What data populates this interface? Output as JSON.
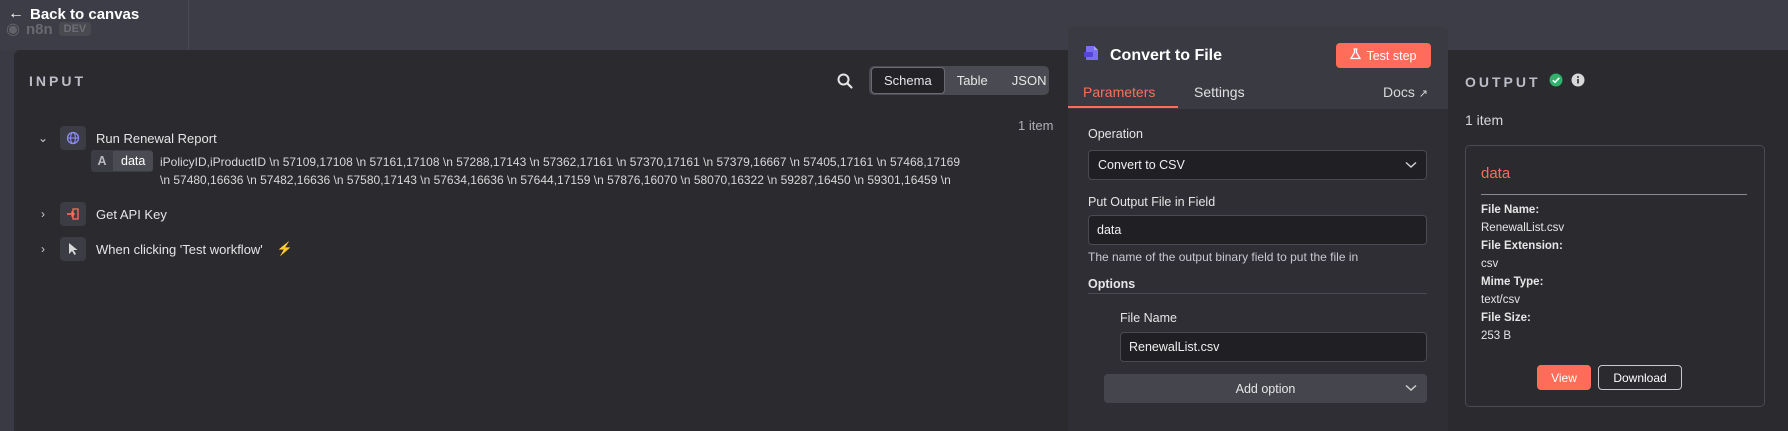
{
  "topbar": {
    "back_label": "Back to canvas",
    "brand_name": "n8n",
    "brand_env": "DEV"
  },
  "input": {
    "title": "INPUT",
    "view_modes": [
      "Schema",
      "Table",
      "JSON"
    ],
    "active_view": "Schema",
    "nodes": [
      {
        "label": "Run Renewal Report",
        "count": "1 item",
        "expanded": true,
        "icon": "globe-icon"
      },
      {
        "label": "Get API Key",
        "expanded": false,
        "icon": "sign-in-icon"
      },
      {
        "label": "When clicking 'Test workflow'",
        "expanded": false,
        "icon": "pointer-icon"
      }
    ],
    "field": {
      "type_letter": "A",
      "key": "data",
      "value_line1": "iPolicyID,iProductID \\n 57109,17108 \\n 57161,17108 \\n 57288,17143 \\n 57362,17161 \\n 57370,17161 \\n 57379,16667 \\n 57405,17161 \\n 57468,17169",
      "value_line2": "\\n 57480,16636 \\n 57482,16636 \\n 57580,17143 \\n 57634,16636 \\n 57644,17159 \\n 57876,16070 \\n 58070,16322 \\n 59287,16450 \\n 59301,16459 \\n"
    }
  },
  "node_panel": {
    "title": "Convert to File",
    "test_step_label": "Test step",
    "tabs": [
      "Parameters",
      "Settings"
    ],
    "active_tab": "Parameters",
    "docs_label": "Docs",
    "operation_label": "Operation",
    "operation_value": "Convert to CSV",
    "output_field_label": "Put Output File in Field",
    "output_field_value": "data",
    "output_field_hint": "The name of the output binary field to put the file in",
    "options_title": "Options",
    "file_name_label": "File Name",
    "file_name_value": "RenewalList.csv",
    "add_option_label": "Add option"
  },
  "output": {
    "title": "OUTPUT",
    "count": "1 item",
    "binary": {
      "name": "data",
      "file_name_label": "File Name:",
      "file_name": "RenewalList.csv",
      "file_ext_label": "File Extension:",
      "file_ext": "csv",
      "mime_label": "Mime Type:",
      "mime": "text/csv",
      "size_label": "File Size:",
      "size": "253 B",
      "view_label": "View",
      "download_label": "Download"
    }
  },
  "colors": {
    "accent": "#ff6d5a",
    "success": "#2fb26a",
    "panel_bg": "#2a2a2f"
  }
}
